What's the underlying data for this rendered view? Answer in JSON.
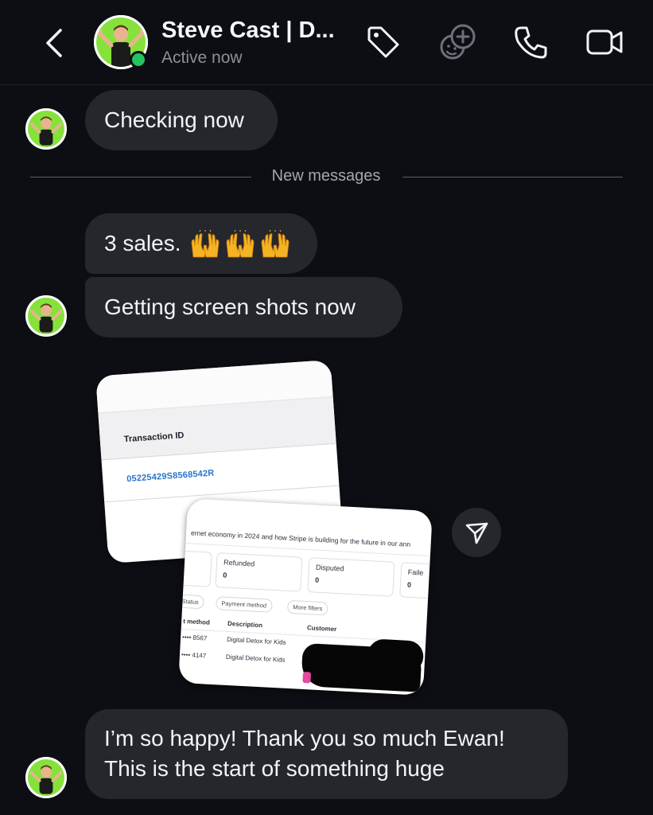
{
  "header": {
    "contact_name": "Steve Cast | D...",
    "status": "Active now",
    "icons": [
      "back-chevron-icon",
      "tag-icon",
      "add-sticker-icon",
      "phone-icon",
      "video-camera-icon"
    ]
  },
  "messages": [
    {
      "text": "Checking now"
    },
    {
      "text": "3 sales."
    },
    {
      "text": "Getting screen shots now"
    },
    {
      "text_line1": "I’m so happy! Thank you so much Ewan!",
      "text_line2": "This is the start of something huge"
    }
  ],
  "divider": {
    "label": "New messages"
  },
  "screenshot_1": {
    "column_header": "Transaction ID",
    "transaction_id": "05225429S8568542R"
  },
  "screenshot_2": {
    "banner": "ernet economy in 2024 and how Stripe is building for the future in our ann",
    "cards": [
      {
        "label": "Refunded",
        "value": "0"
      },
      {
        "label": "Disputed",
        "value": "0"
      },
      {
        "label": "Faile",
        "value": "0"
      }
    ],
    "filters": [
      "Status",
      "Payment method",
      "More filters"
    ],
    "columns": [
      "t method",
      "Description",
      "Customer"
    ],
    "rows": [
      {
        "card": "•••• 8567",
        "description": "Digital Detox for Kids"
      },
      {
        "card": "•••• 4147",
        "description": "Digital Detox for Kids"
      }
    ]
  },
  "colors": {
    "background": "#0c0e13",
    "bubble": "#25272d",
    "online": "#22c55e",
    "link_blue": "#2b74c8"
  }
}
